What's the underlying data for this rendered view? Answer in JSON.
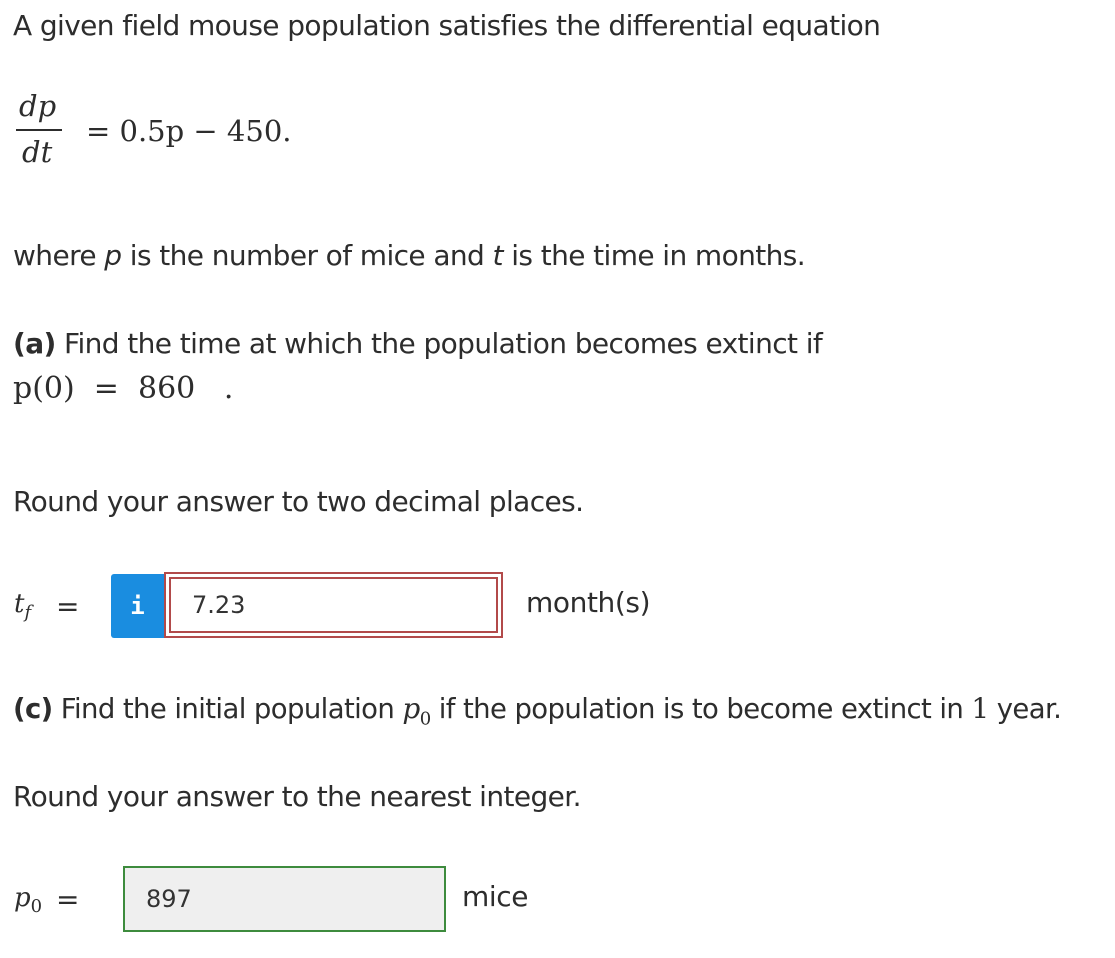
{
  "intro": {
    "text": "A given field mouse population satisfies the differential equation"
  },
  "equation": {
    "numerator": "dp",
    "denominator": "dt",
    "rhs": "= 0.5p − 450."
  },
  "where": {
    "prefix": "where ",
    "var_p": "p",
    "middle": " is the number of mice and ",
    "var_t": "t",
    "suffix": " is the time in months."
  },
  "part_a": {
    "label": "(a)",
    "question": " Find the time at which the population becomes extinct if",
    "condition": "p(0)  =  860   .",
    "instruction": "Round your answer to two decimal places.",
    "answer_lhs_var": "t",
    "answer_lhs_sub": "f",
    "answer_eq": "=",
    "info_icon_glyph": "i",
    "answer_value": "7.23",
    "unit": "month(s)"
  },
  "part_c": {
    "label": "(c)",
    "question_before": " Find the initial population ",
    "var": "p",
    "var_sub": "0",
    "question_after": " if the population is to become extinct in ",
    "number": "1",
    "question_end": " year.",
    "instruction": "Round your answer to the nearest integer.",
    "answer_lhs_var": "p",
    "answer_lhs_sub": "0",
    "answer_eq": "=",
    "answer_value": "897",
    "unit": "mice"
  },
  "colors": {
    "text": "#2d2d2d",
    "info_button": "#1a8de0",
    "incorrect_border": "#b24a4a",
    "correct_border": "#3d8b3d",
    "correct_field_bg": "#efefef"
  }
}
